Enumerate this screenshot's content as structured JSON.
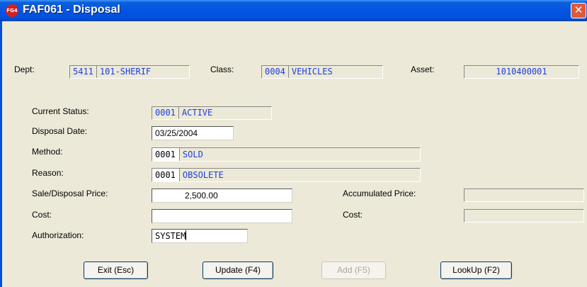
{
  "window": {
    "title": "FAF061 - Disposal",
    "icon_text": "FG4",
    "icon_name": "app-icon",
    "close_glyph": "✕"
  },
  "header": {
    "dept_label": "Dept:",
    "dept_code": "5411",
    "dept_desc": "101-SHERIF",
    "class_label": "Class:",
    "class_code": "0004",
    "class_desc": "VEHICLES",
    "asset_label": "Asset:",
    "asset_value": "1010400001"
  },
  "form": {
    "status_label": "Current Status:",
    "status_code": "0001",
    "status_desc": "ACTIVE",
    "disposal_date_label": "Disposal Date:",
    "disposal_date": "03/25/2004",
    "method_label": "Method:",
    "method_code": "0001",
    "method_desc": "SOLD",
    "reason_label": "Reason:",
    "reason_code": "0001",
    "reason_desc": "OBSOLETE",
    "sale_price_label": "Sale/Disposal Price:",
    "sale_price": "2,500.00",
    "cost_label": "Cost:",
    "cost_value": "",
    "authorization_label": "Authorization:",
    "authorization_value": "SYSTEM",
    "accumulated_price_label": "Accumulated Price:",
    "accumulated_price_value": "",
    "cost2_label": "Cost:",
    "cost2_value": ""
  },
  "buttons": {
    "exit": "Exit (Esc)",
    "update": "Update (F4)",
    "add": "Add (F5)",
    "lookup": "LookUp (F2)"
  },
  "colors": {
    "titlebar": "#0554e3",
    "dialog_bg": "#ece9d8",
    "readonly_text": "#1a3fe0",
    "close_button": "#e0593a"
  }
}
